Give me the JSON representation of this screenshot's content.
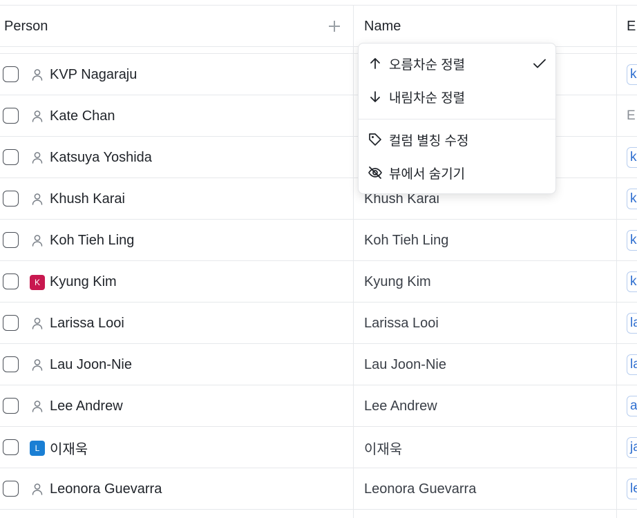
{
  "columns": {
    "person": "Person",
    "name": "Name",
    "email": "E"
  },
  "rows": [
    {
      "person": "KVP Nagaraju",
      "name": "",
      "email_chip": "k",
      "avatar": "person-icon"
    },
    {
      "person": "Kate Chan",
      "name": "",
      "email_text": "E",
      "avatar": "person-icon"
    },
    {
      "person": "Katsuya Yoshida",
      "name": "",
      "email_chip": "k",
      "avatar": "person-icon"
    },
    {
      "person": "Khush Karai",
      "name": "Khush Karai",
      "email_chip": "k",
      "avatar": "person-icon"
    },
    {
      "person": "Koh Tieh Ling",
      "name": "Koh Tieh Ling",
      "email_chip": "k",
      "avatar": "person-icon"
    },
    {
      "person": "Kyung Kim",
      "name": "Kyung Kim",
      "email_chip": "k",
      "avatar": "badge",
      "badge_letter": "K",
      "badge_color": "#c8184f"
    },
    {
      "person": "Larissa Looi",
      "name": "Larissa Looi",
      "email_chip": "la",
      "avatar": "person-icon"
    },
    {
      "person": "Lau Joon-Nie",
      "name": "Lau Joon-Nie",
      "email_chip": "la",
      "avatar": "person-icon"
    },
    {
      "person": "Lee Andrew",
      "name": "Lee Andrew",
      "email_chip": "a",
      "avatar": "person-icon"
    },
    {
      "person": "이재욱",
      "name": "이재욱",
      "email_chip": "ja",
      "avatar": "badge",
      "badge_letter": "L",
      "badge_color": "#1a7fd4"
    },
    {
      "person": "Leonora Guevarra",
      "name": "Leonora Guevarra",
      "email_chip": "le",
      "avatar": "person-icon"
    }
  ],
  "column_menu": {
    "sort_asc": "오름차순 정렬",
    "sort_desc": "내림차순 정렬",
    "edit_alias": "컬럼 별칭 수정",
    "hide_in_view": "뷰에서 숨기기",
    "selected": "sort_asc"
  },
  "colors": {
    "accent_blue": "#2f6fd0",
    "border": "#e6e8eb"
  }
}
